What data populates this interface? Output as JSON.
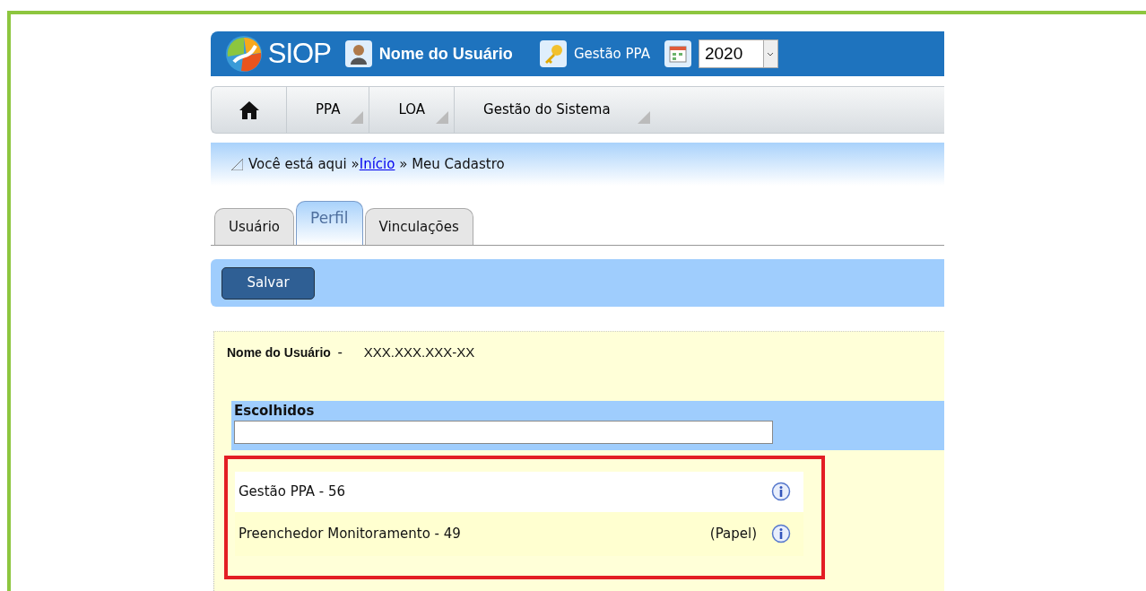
{
  "header": {
    "logo_text": "SIOP",
    "user": "Nome do Usuário",
    "module": "Gestão PPA",
    "year": "2020"
  },
  "menu": {
    "items": [
      {
        "label": "PPA",
        "has_submenu": true
      },
      {
        "label": "LOA",
        "has_submenu": true
      },
      {
        "label": "Gestão do Sistema",
        "has_submenu": true
      }
    ]
  },
  "breadcrumb": {
    "prefix": "Você está aqui »",
    "link": "Início",
    "rest": "» Meu Cadastro"
  },
  "tabs": [
    {
      "label": "Usuário",
      "selected": false
    },
    {
      "label": "Perfil",
      "selected": true
    },
    {
      "label": "Vinculações",
      "selected": false
    }
  ],
  "buttons": [
    "Salvar"
  ],
  "form": {
    "label": "Nome do Usuário",
    "separator": "-",
    "value": "XXX.XXX.XXX-XX",
    "section_title": "Escolhidos",
    "items": [
      {
        "text": "Gestão PPA - 56"
      },
      {
        "text": "Preenchedor Monitoramento - 49",
        "tag": "(Papel)"
      }
    ],
    "highlighted": true
  }
}
